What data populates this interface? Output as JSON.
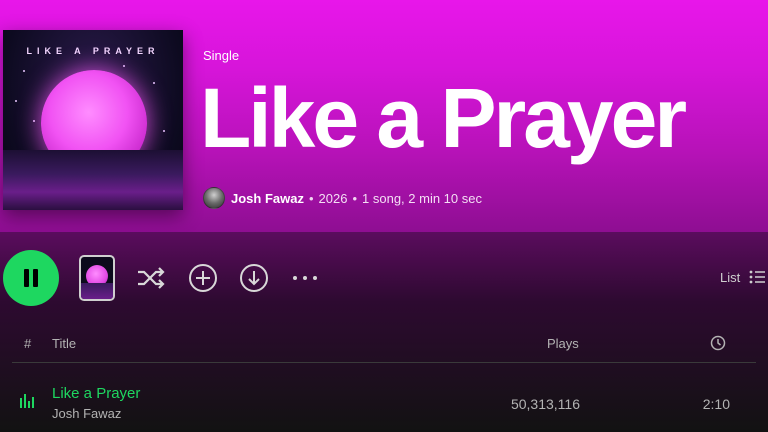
{
  "header": {
    "type_label": "Single",
    "title": "Like a Prayer",
    "cover_title": "LIKE A PRAYER",
    "artist": "Josh Fawaz",
    "year": "2026",
    "summary": "1 song, 2 min 10 sec",
    "separator": "•"
  },
  "actions": {
    "play_state": "pause",
    "view_mode_label": "List"
  },
  "icons": [
    "pause-icon",
    "shuffle-icon",
    "add-icon",
    "download-icon",
    "more-icon",
    "list-icon",
    "clock-icon",
    "equalizer-icon"
  ],
  "table": {
    "columns": {
      "index": "#",
      "title": "Title",
      "plays": "Plays"
    },
    "rows": [
      {
        "title": "Like a Prayer",
        "artist": "Josh Fawaz",
        "plays": "50,313,116",
        "duration": "2:10",
        "playing": true
      }
    ]
  },
  "colors": {
    "accent": "#1ed760",
    "header_top": "#e816ea",
    "header_bottom": "#8e0e92",
    "background": "#121212"
  }
}
